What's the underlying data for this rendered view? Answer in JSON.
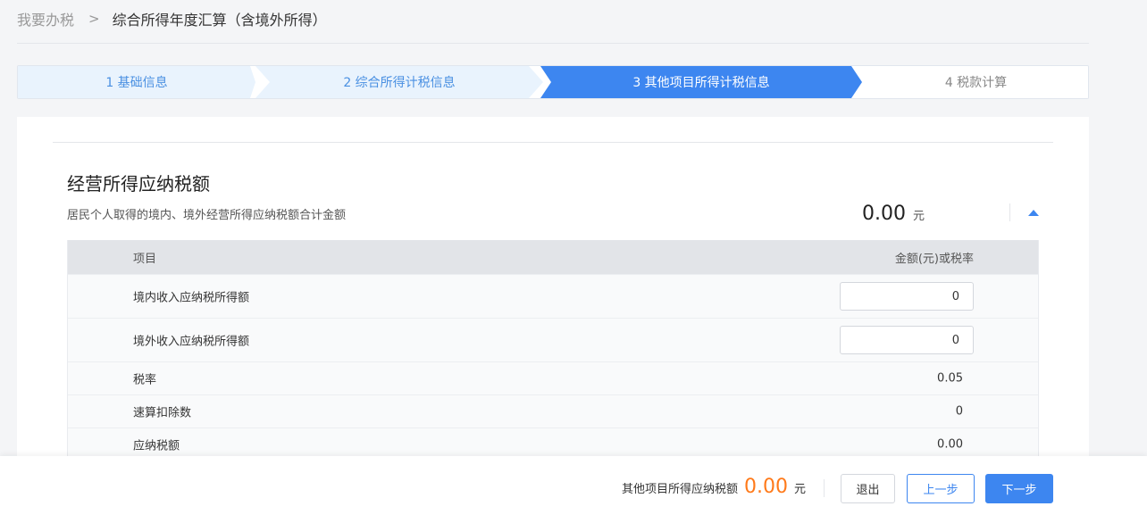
{
  "breadcrumb": {
    "home": "我要办税",
    "current": "综合所得年度汇算（含境外所得）"
  },
  "steps": [
    {
      "label": "1 基础信息",
      "state": "done"
    },
    {
      "label": "2 综合所得计税信息",
      "state": "done"
    },
    {
      "label": "3 其他项目所得计税信息",
      "state": "active"
    },
    {
      "label": "4 税款计算",
      "state": "todo"
    }
  ],
  "section": {
    "title": "经营所得应纳税额",
    "description": "居民个人取得的境内、境外经营所得应纳税额合计金额",
    "total_value": "0.00",
    "total_unit": "元",
    "collapsed": false
  },
  "table": {
    "headers": [
      "项目",
      "金额(元)或税率"
    ],
    "rows": [
      {
        "label": "境内收入应纳税所得额",
        "value": "0",
        "editable": true
      },
      {
        "label": "境外收入应纳税所得额",
        "value": "0",
        "editable": true
      },
      {
        "label": "税率",
        "value": "0.05",
        "editable": false
      },
      {
        "label": "速算扣除数",
        "value": "0",
        "editable": false
      },
      {
        "label": "应纳税额",
        "value": "0.00",
        "editable": false
      }
    ]
  },
  "footer": {
    "summary_label": "其他项目所得应纳税额",
    "summary_value": "0.00",
    "summary_unit": "元",
    "exit_label": "退出",
    "prev_label": "上一步",
    "next_label": "下一步"
  },
  "colors": {
    "accent": "#3d86f0",
    "step_done_bg": "#e9f3fd",
    "highlight_amount": "#ff7a1a"
  }
}
